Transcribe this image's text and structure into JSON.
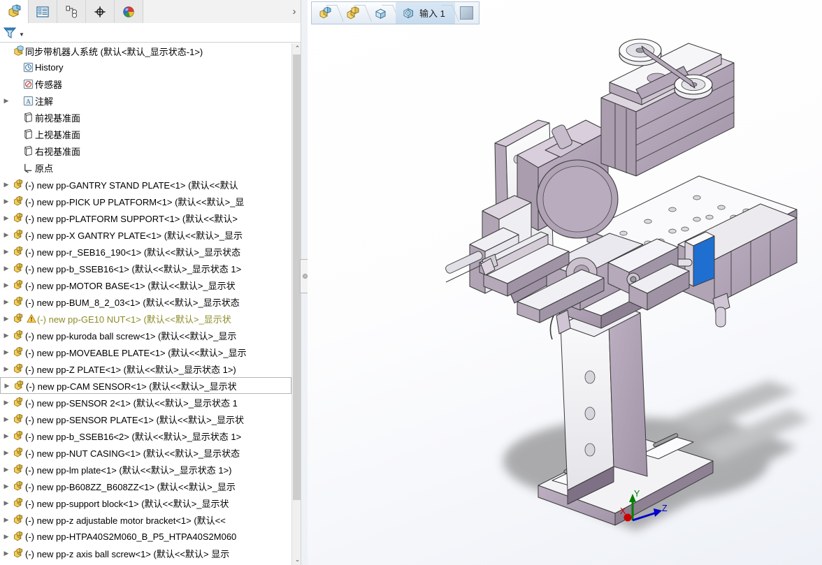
{
  "app": {
    "title": "SOLIDWORKS Assembly",
    "panel_tabs": [
      {
        "name": "feature-manager-design-tree",
        "icon": "assembly-tree-icon",
        "active": true
      },
      {
        "name": "property-manager",
        "icon": "property-list-icon",
        "active": false
      },
      {
        "name": "configuration-manager",
        "icon": "configuration-icon",
        "active": false
      },
      {
        "name": "dimxpert-manager",
        "icon": "dimxpert-target-icon",
        "active": false
      },
      {
        "name": "display-manager",
        "icon": "appearance-sphere-icon",
        "active": false
      }
    ],
    "panel_expand_label": "›"
  },
  "filter_bar": {
    "icon": "filter-funnel-icon",
    "caret": "▼",
    "placeholder": ""
  },
  "tree": {
    "root": {
      "label": "同步带机器人系统  (默认<默认_显示状态-1>)",
      "icon": "assembly-icon",
      "has_arrow": false
    },
    "items": [
      {
        "label": "History",
        "icon": "history-icon",
        "arrow": false,
        "indent": 1,
        "warn": false,
        "focus": false
      },
      {
        "label": "传感器",
        "icon": "sensor-icon",
        "arrow": false,
        "indent": 1,
        "warn": false,
        "focus": false
      },
      {
        "label": "注解",
        "icon": "annotation-icon",
        "arrow": true,
        "indent": 1,
        "warn": false,
        "focus": false
      },
      {
        "label": "前视基准面",
        "icon": "plane-icon",
        "arrow": false,
        "indent": 1,
        "warn": false,
        "focus": false
      },
      {
        "label": "上视基准面",
        "icon": "plane-icon",
        "arrow": false,
        "indent": 1,
        "warn": false,
        "focus": false
      },
      {
        "label": "右视基准面",
        "icon": "plane-icon",
        "arrow": false,
        "indent": 1,
        "warn": false,
        "focus": false
      },
      {
        "label": "原点",
        "icon": "origin-icon",
        "arrow": false,
        "indent": 1,
        "warn": false,
        "focus": false
      },
      {
        "label": "(-) new pp-GANTRY STAND PLATE<1>  (默认<<默认",
        "icon": "component-icon",
        "arrow": true,
        "indent": 0,
        "warn": false,
        "focus": false
      },
      {
        "label": "(-) new pp-PICK UP PLATFORM<1>  (默认<<默认>_显",
        "icon": "component-icon",
        "arrow": true,
        "indent": 0,
        "warn": false,
        "focus": false
      },
      {
        "label": "(-) new pp-PLATFORM SUPPORT<1>  (默认<<默认>",
        "icon": "component-icon",
        "arrow": true,
        "indent": 0,
        "warn": false,
        "focus": false
      },
      {
        "label": "(-) new pp-X GANTRY PLATE<1>  (默认<<默认>_显示",
        "icon": "component-icon",
        "arrow": true,
        "indent": 0,
        "warn": false,
        "focus": false
      },
      {
        "label": "(-) new pp-r_SEB16_190<1>  (默认<<默认>_显示状态",
        "icon": "component-icon",
        "arrow": true,
        "indent": 0,
        "warn": false,
        "focus": false
      },
      {
        "label": "(-) new pp-b_SSEB16<1>  (默认<<默认>_显示状态 1>",
        "icon": "component-icon",
        "arrow": true,
        "indent": 0,
        "warn": false,
        "focus": false
      },
      {
        "label": "(-) new pp-MOTOR BASE<1>  (默认<<默认>_显示状",
        "icon": "component-icon",
        "arrow": true,
        "indent": 0,
        "warn": false,
        "focus": false
      },
      {
        "label": "(-) new pp-BUM_8_2_03<1>  (默认<<默认>_显示状态",
        "icon": "component-icon",
        "arrow": true,
        "indent": 0,
        "warn": false,
        "focus": false
      },
      {
        "label": "(-) new pp-GE10 NUT<1>  (默认<<默认>_显示状",
        "icon": "component-icon",
        "arrow": true,
        "indent": 0,
        "warn": true,
        "focus": false
      },
      {
        "label": "(-) new pp-kuroda ball screw<1>  (默认<<默认>_显示",
        "icon": "component-icon",
        "arrow": true,
        "indent": 0,
        "warn": false,
        "focus": false
      },
      {
        "label": "(-) new pp-MOVEABLE PLATE<1>  (默认<<默认>_显示",
        "icon": "component-icon",
        "arrow": true,
        "indent": 0,
        "warn": false,
        "focus": false
      },
      {
        "label": "(-) new pp-Z PLATE<1>  (默认<<默认>_显示状态 1>)",
        "icon": "component-icon",
        "arrow": true,
        "indent": 0,
        "warn": false,
        "focus": false
      },
      {
        "label": "(-) new pp-CAM SENSOR<1>  (默认<<默认>_显示状",
        "icon": "component-icon",
        "arrow": true,
        "indent": 0,
        "warn": false,
        "focus": true
      },
      {
        "label": "(-) new pp-SENSOR 2<1>  (默认<<默认>_显示状态 1",
        "icon": "component-icon",
        "arrow": true,
        "indent": 0,
        "warn": false,
        "focus": false
      },
      {
        "label": "(-) new pp-SENSOR PLATE<1>  (默认<<默认>_显示状",
        "icon": "component-icon",
        "arrow": true,
        "indent": 0,
        "warn": false,
        "focus": false
      },
      {
        "label": "(-) new pp-b_SSEB16<2>  (默认<<默认>_显示状态 1>",
        "icon": "component-icon",
        "arrow": true,
        "indent": 0,
        "warn": false,
        "focus": false
      },
      {
        "label": "(-) new pp-NUT CASING<1>  (默认<<默认>_显示状态",
        "icon": "component-icon",
        "arrow": true,
        "indent": 0,
        "warn": false,
        "focus": false
      },
      {
        "label": "(-) new pp-lm plate<1>  (默认<<默认>_显示状态 1>)",
        "icon": "component-icon",
        "arrow": true,
        "indent": 0,
        "warn": false,
        "focus": false
      },
      {
        "label": "(-) new pp-B608ZZ_B608ZZ<1>  (默认<<默认>_显示",
        "icon": "component-icon",
        "arrow": true,
        "indent": 0,
        "warn": false,
        "focus": false
      },
      {
        "label": "(-) new pp-support block<1>  (默认<<默认>_显示状",
        "icon": "component-icon",
        "arrow": true,
        "indent": 0,
        "warn": false,
        "focus": false
      },
      {
        "label": "(-) new pp-z adjustable motor bracket<1>  (默认<<",
        "icon": "component-icon",
        "arrow": true,
        "indent": 0,
        "warn": false,
        "focus": false
      },
      {
        "label": "(-) new pp-HTPA40S2M060_B_P5_HTPA40S2M060",
        "icon": "component-icon",
        "arrow": true,
        "indent": 0,
        "warn": false,
        "focus": false
      },
      {
        "label": "(-) new pp-z axis ball screw<1>  (默认<<默认>  显示",
        "icon": "component-icon",
        "arrow": true,
        "indent": 0,
        "warn": false,
        "focus": false
      }
    ]
  },
  "breadcrumb": {
    "crumbs": [
      {
        "icon": "assembly-cube-icon",
        "text": ""
      },
      {
        "icon": "subassembly-cube-icon",
        "text": ""
      },
      {
        "icon": "part-cube-icon",
        "text": ""
      },
      {
        "icon": "imported-feature-icon",
        "text": "输入 1"
      }
    ],
    "end_button": {
      "name": "filter-toggle-button",
      "icon": "square-icon"
    }
  },
  "viewport": {
    "triad": {
      "axes": [
        {
          "name": "X",
          "color": "#cc0000"
        },
        {
          "name": "Y",
          "color": "#008000"
        },
        {
          "name": "Z",
          "color": "#0000cc"
        }
      ]
    },
    "selection": {
      "color": "#1f6fd0",
      "cursor": "crosshair-plus"
    },
    "model_name": "同步带机器人系统",
    "colors": {
      "part_purple": "#b3a6b8",
      "part_light": "#efeff2",
      "part_white": "#fafafa",
      "edge": "#3a3a3a",
      "shadow": "#6a6a6a"
    }
  },
  "scrollbar": {
    "up_arrow": "⌃",
    "down_arrow": "⌄"
  }
}
